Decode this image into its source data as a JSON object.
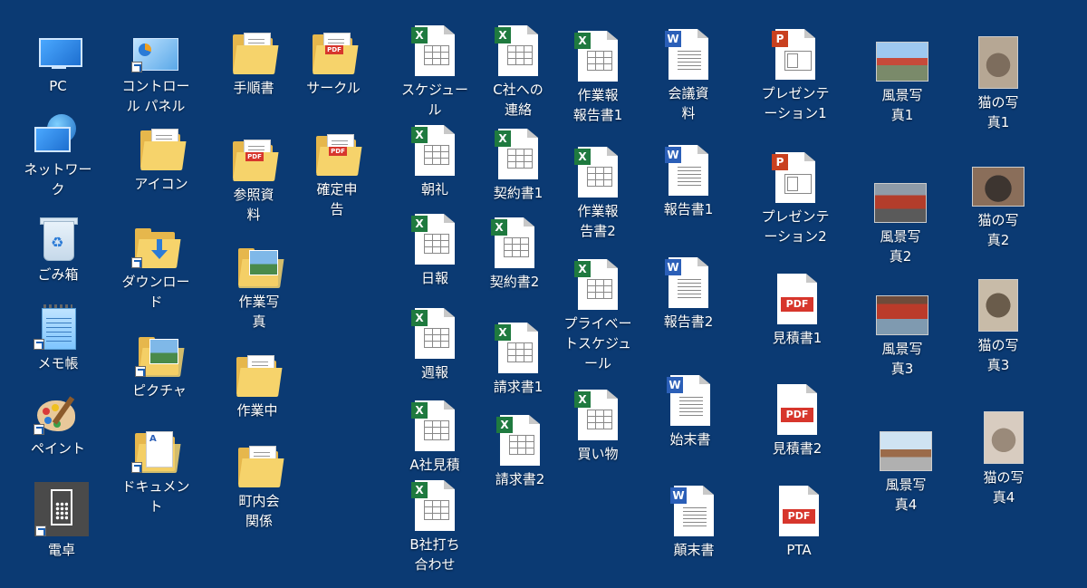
{
  "desktop": {
    "background_color": "#0b3a73",
    "icons": [
      {
        "label": "PC",
        "icon": "pc-icon"
      },
      {
        "label": "ネットワー\nク",
        "icon": "network-icon"
      },
      {
        "label": "ごみ箱",
        "icon": "recycle-bin-icon"
      },
      {
        "label": "メモ帳",
        "icon": "notepad-icon"
      },
      {
        "label": "ペイント",
        "icon": "paint-icon"
      },
      {
        "label": "電卓",
        "icon": "calculator-icon"
      },
      {
        "label": "コントロー\nル パネル",
        "icon": "control-panel-icon"
      },
      {
        "label": "アイコン",
        "icon": "folder-icon"
      },
      {
        "label": "ダウンロー\nド",
        "icon": "downloads-folder-icon"
      },
      {
        "label": "ピクチャ",
        "icon": "pictures-folder-icon"
      },
      {
        "label": "ドキュメン\nト",
        "icon": "documents-folder-icon"
      },
      {
        "label": "手順書",
        "icon": "folder-icon"
      },
      {
        "label": "参照資\n料",
        "icon": "pdf-folder-icon"
      },
      {
        "label": "作業写\n真",
        "icon": "photo-folder-icon"
      },
      {
        "label": "作業中",
        "icon": "folder-icon"
      },
      {
        "label": "町内会\n関係",
        "icon": "folder-icon"
      },
      {
        "label": "サークル",
        "icon": "pdf-folder-icon"
      },
      {
        "label": "確定申\n告",
        "icon": "pdf-folder-icon"
      },
      {
        "label": "スケジュー\nル",
        "icon": "excel-icon"
      },
      {
        "label": "朝礼",
        "icon": "excel-icon"
      },
      {
        "label": "日報",
        "icon": "excel-icon"
      },
      {
        "label": "週報",
        "icon": "excel-icon"
      },
      {
        "label": "A社見積",
        "icon": "excel-icon"
      },
      {
        "label": "B社打ち\n合わせ",
        "icon": "excel-icon"
      },
      {
        "label": "C社への\n連絡",
        "icon": "excel-icon"
      },
      {
        "label": "契約書1",
        "icon": "excel-icon"
      },
      {
        "label": "契約書2",
        "icon": "excel-icon"
      },
      {
        "label": "請求書1",
        "icon": "excel-icon"
      },
      {
        "label": "請求書2",
        "icon": "excel-icon"
      },
      {
        "label": "作業報\n報告書1",
        "icon": "excel-icon"
      },
      {
        "label": "作業報\n告書2",
        "icon": "excel-icon"
      },
      {
        "label": "プライベー\nトスケジュ\nール",
        "icon": "excel-icon"
      },
      {
        "label": "買い物",
        "icon": "excel-icon"
      },
      {
        "label": "会議資\n料",
        "icon": "word-icon"
      },
      {
        "label": "報告書1",
        "icon": "word-icon"
      },
      {
        "label": "報告書2",
        "icon": "word-icon"
      },
      {
        "label": "始末書",
        "icon": "word-icon"
      },
      {
        "label": "顛末書",
        "icon": "word-icon"
      },
      {
        "label": "プレゼンテ\nーション1",
        "icon": "powerpoint-icon"
      },
      {
        "label": "プレゼンテ\nーション2",
        "icon": "powerpoint-icon"
      },
      {
        "label": "見積書1",
        "icon": "pdf-icon"
      },
      {
        "label": "見積書2",
        "icon": "pdf-icon"
      },
      {
        "label": "PTA",
        "icon": "pdf-icon"
      },
      {
        "label": "風景写\n真1",
        "icon": "photo-thumbnail-icon"
      },
      {
        "label": "風景写\n真2",
        "icon": "photo-thumbnail-icon"
      },
      {
        "label": "風景写\n真3",
        "icon": "photo-thumbnail-icon"
      },
      {
        "label": "風景写\n真4",
        "icon": "photo-thumbnail-icon"
      },
      {
        "label": "猫の写\n真1",
        "icon": "photo-thumbnail-icon"
      },
      {
        "label": "猫の写\n真2",
        "icon": "photo-thumbnail-icon"
      },
      {
        "label": "猫の写\n真3",
        "icon": "photo-thumbnail-icon"
      },
      {
        "label": "猫の写\n真4",
        "icon": "photo-thumbnail-icon"
      }
    ],
    "badges": {
      "excel": "X",
      "word": "W",
      "powerpoint": "P",
      "pdf": "PDF"
    }
  }
}
